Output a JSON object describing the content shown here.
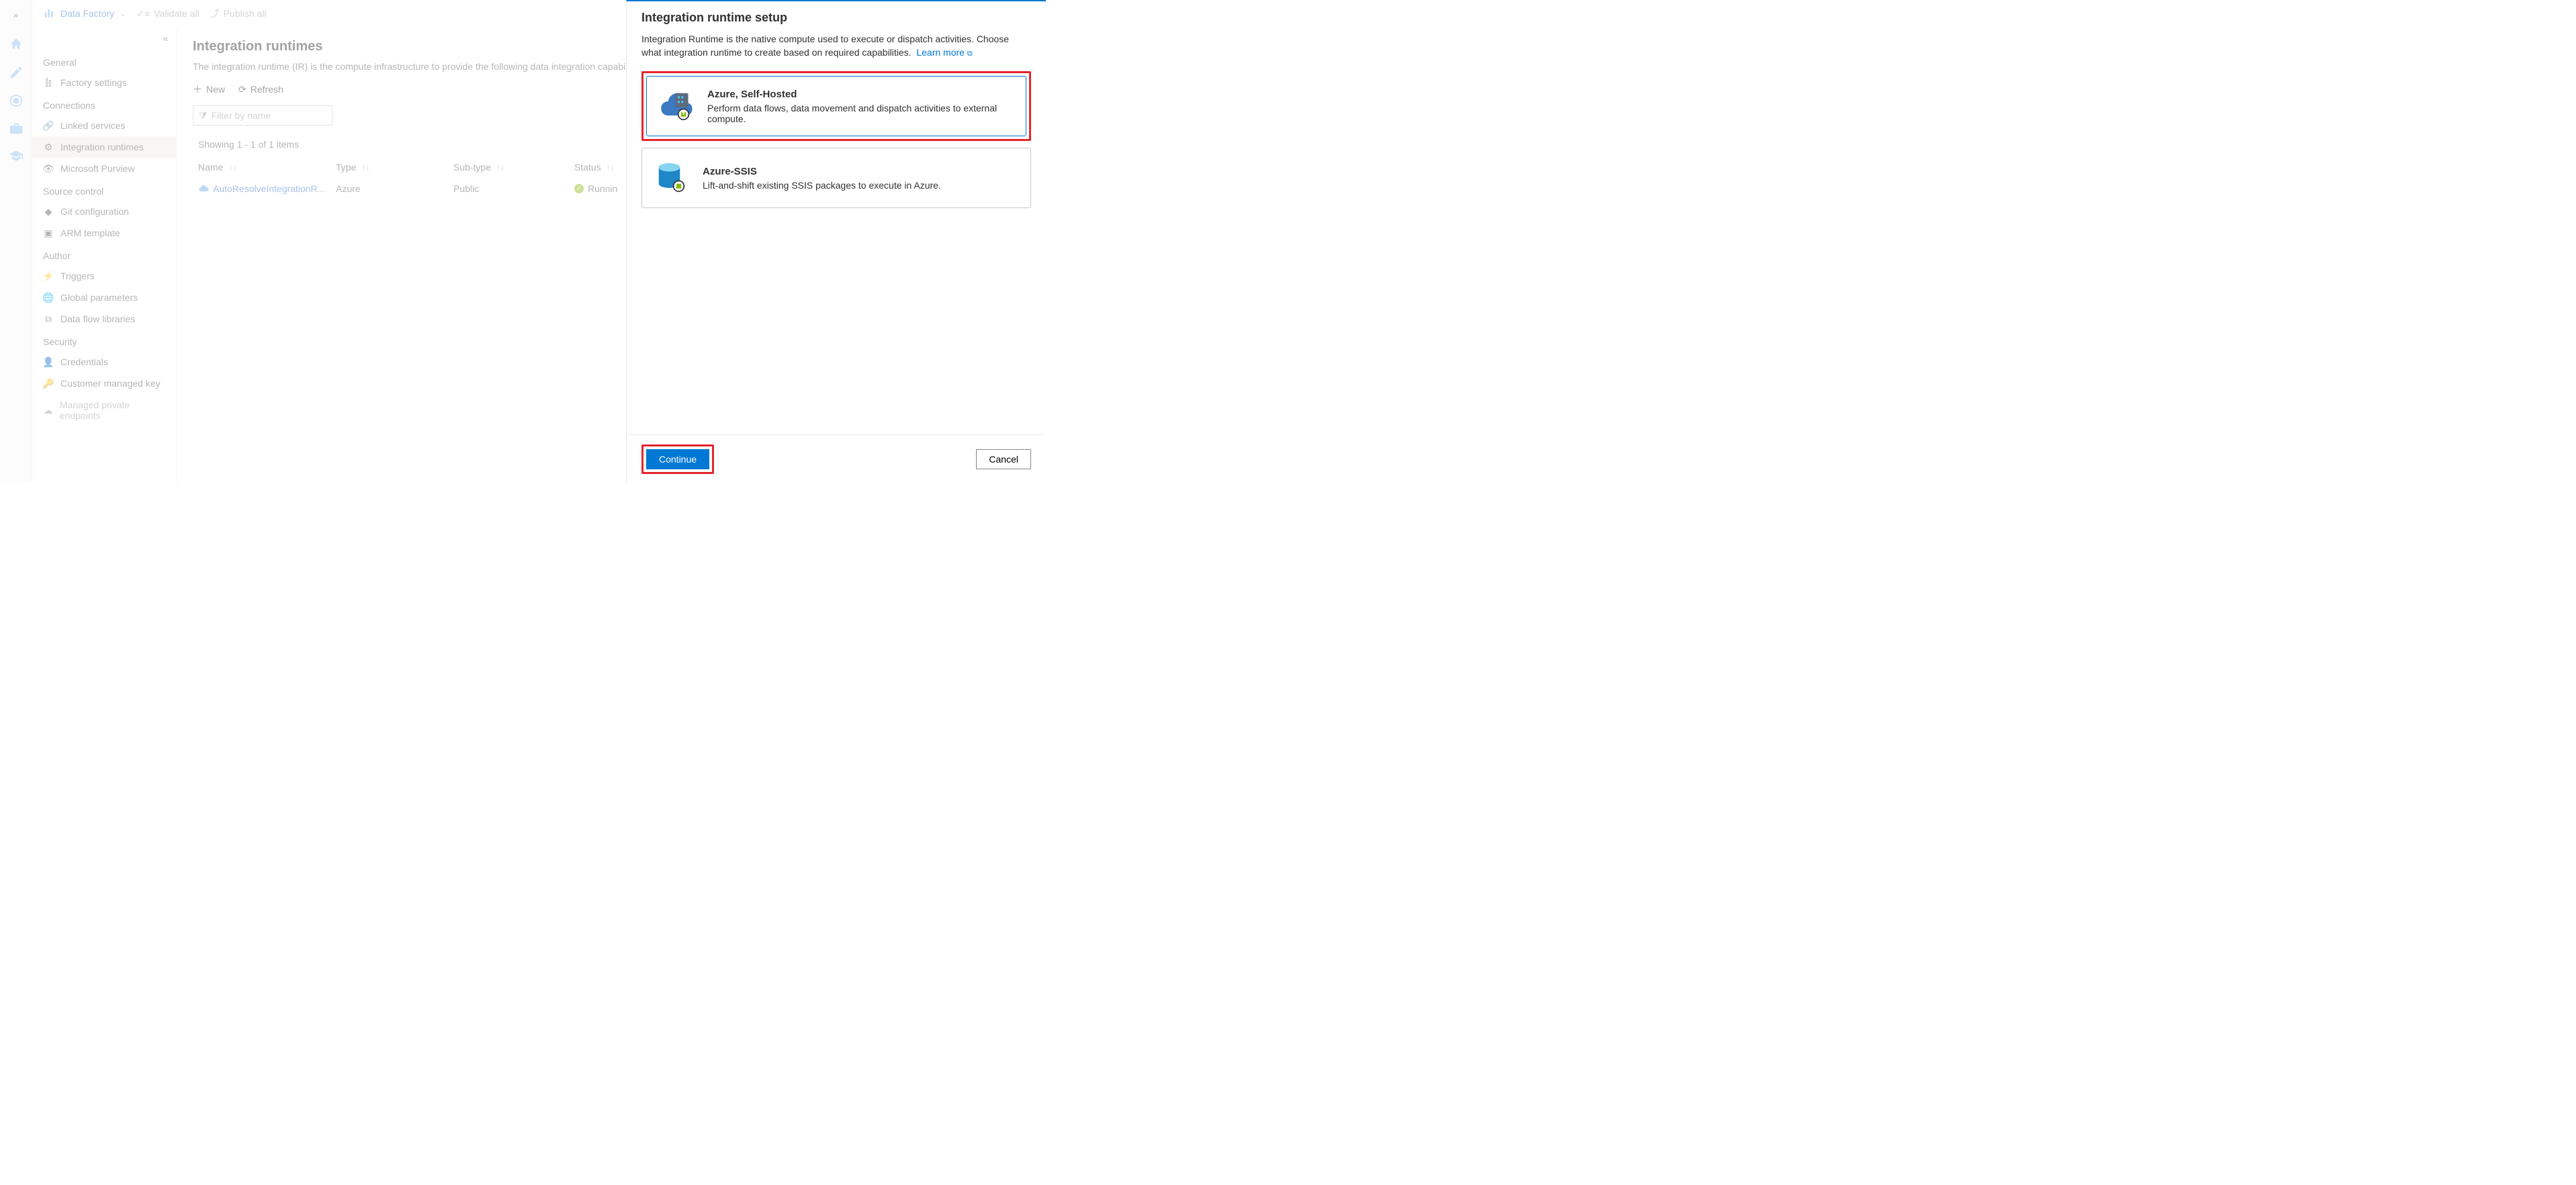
{
  "topbar": {
    "product": "Data Factory",
    "validate": "Validate all",
    "publish": "Publish all"
  },
  "sidebar": {
    "groups": [
      {
        "title": "General",
        "items": [
          {
            "label": "Factory settings"
          }
        ]
      },
      {
        "title": "Connections",
        "items": [
          {
            "label": "Linked services"
          },
          {
            "label": "Integration runtimes",
            "active": true
          },
          {
            "label": "Microsoft Purview"
          }
        ]
      },
      {
        "title": "Source control",
        "items": [
          {
            "label": "Git configuration"
          },
          {
            "label": "ARM template"
          }
        ]
      },
      {
        "title": "Author",
        "items": [
          {
            "label": "Triggers"
          },
          {
            "label": "Global parameters"
          },
          {
            "label": "Data flow libraries"
          }
        ]
      },
      {
        "title": "Security",
        "items": [
          {
            "label": "Credentials"
          },
          {
            "label": "Customer managed key"
          },
          {
            "label": "Managed private endpoints",
            "disabled": true
          }
        ]
      }
    ]
  },
  "page": {
    "title": "Integration runtimes",
    "desc": "The integration runtime (IR) is the compute infrastructure to provide the following data integration capabilities",
    "new": "New",
    "refresh": "Refresh",
    "filter_placeholder": "Filter by name",
    "count": "Showing 1 - 1 of 1 items",
    "cols": {
      "name": "Name",
      "type": "Type",
      "sub": "Sub-type",
      "status": "Status"
    },
    "rows": [
      {
        "name": "AutoResolveIntegrationR...",
        "type": "Azure",
        "sub": "Public",
        "status": "Runnin"
      }
    ]
  },
  "blade": {
    "title": "Integration runtime setup",
    "intro": "Integration Runtime is the native compute used to execute or dispatch activities. Choose what integration runtime to create based on required capabilities.",
    "learn": "Learn more",
    "options": [
      {
        "title": "Azure, Self-Hosted",
        "desc": "Perform data flows, data movement and dispatch activities to external compute.",
        "selected": true
      },
      {
        "title": "Azure-SSIS",
        "desc": "Lift-and-shift existing SSIS packages to execute in Azure."
      }
    ],
    "continue": "Continue",
    "cancel": "Cancel"
  }
}
